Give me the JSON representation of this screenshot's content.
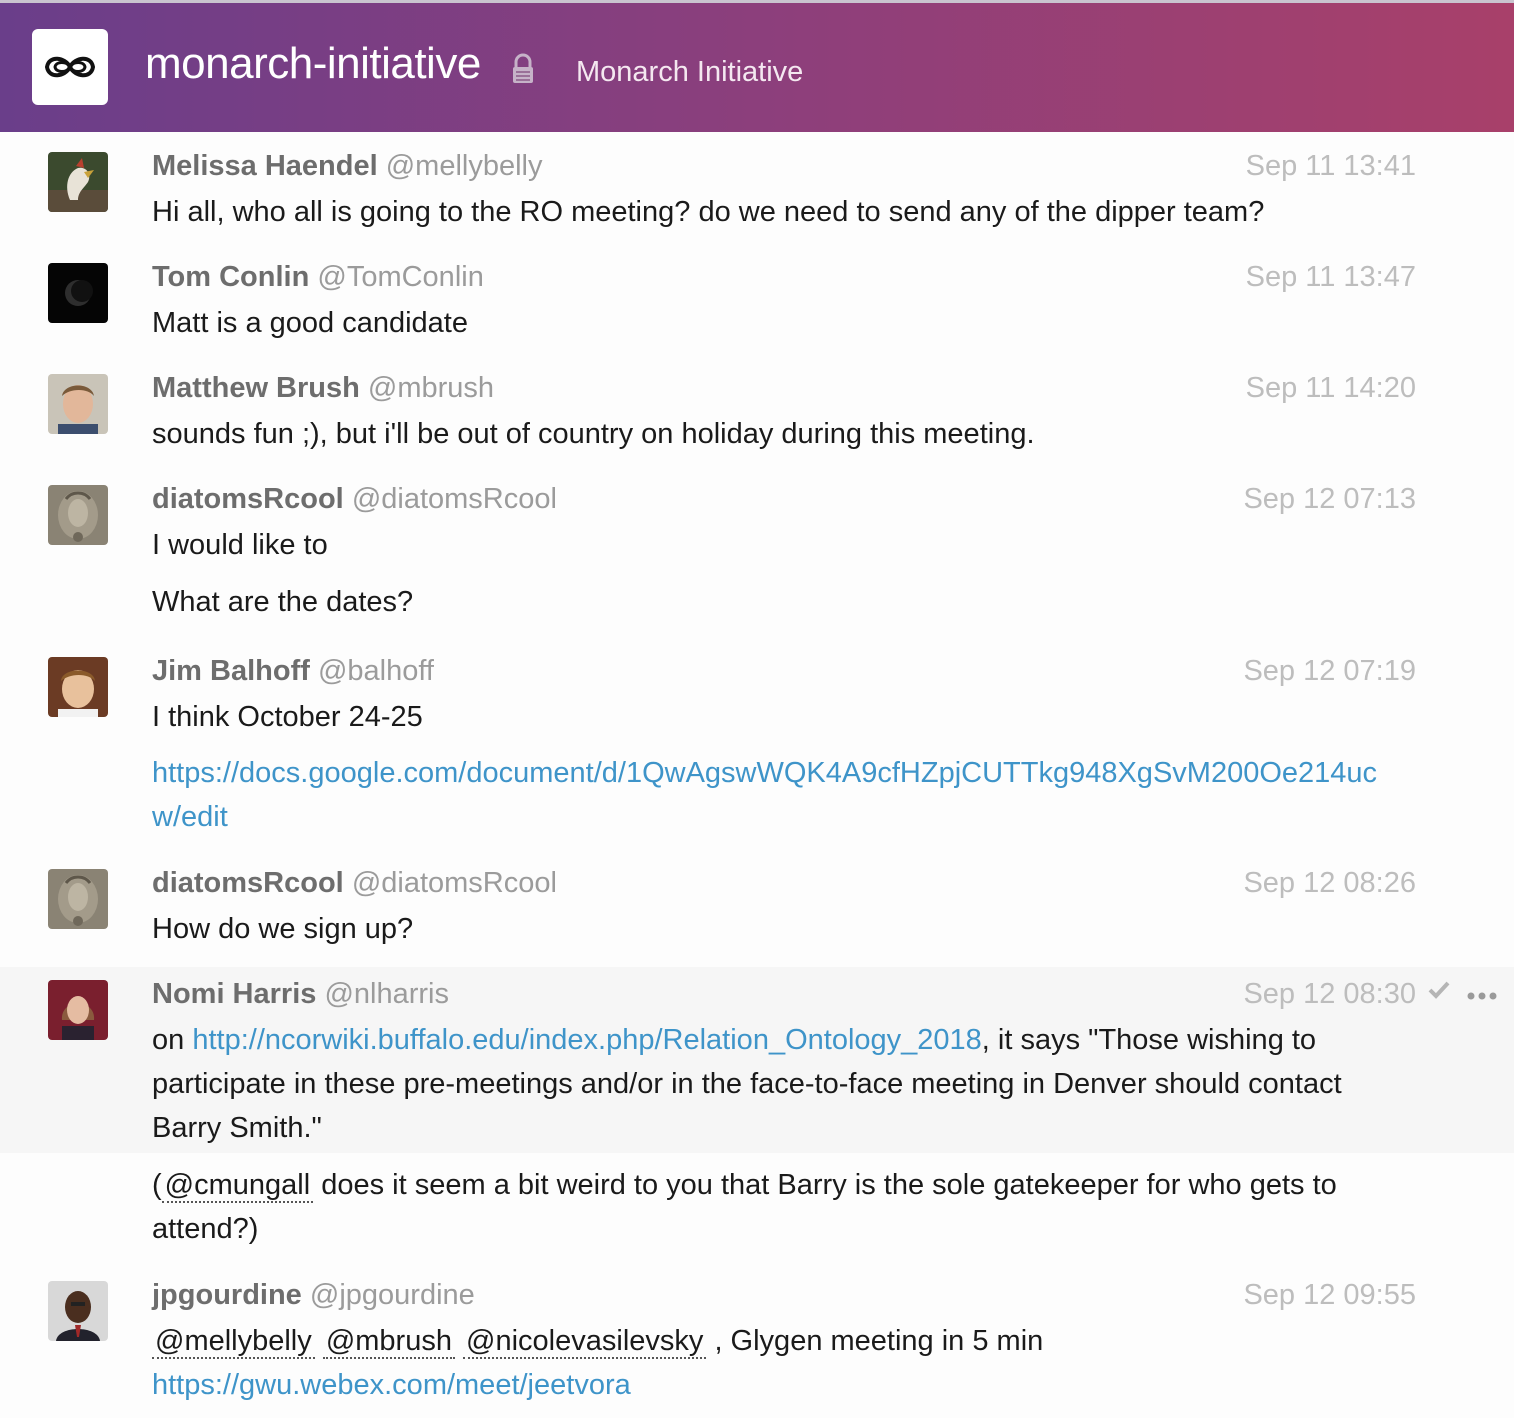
{
  "header": {
    "room_name": "monarch-initiative",
    "room_topic": "Monarch Initiative"
  },
  "messages": [
    {
      "display_name": "Melissa Haendel",
      "username": "@mellybelly",
      "timestamp": "Sep 11 13:41",
      "text": "Hi all, who all is going to the RO meeting? do we need to send any of the dipper team?"
    },
    {
      "display_name": "Tom Conlin",
      "username": "@TomConlin",
      "timestamp": "Sep 11 13:47",
      "text": "Matt is a good candidate"
    },
    {
      "display_name": "Matthew Brush",
      "username": "@mbrush",
      "timestamp": "Sep 11 14:20",
      "text": "sounds fun ;), but i'll be out of country on holiday during this meeting."
    },
    {
      "display_name": "diatomsRcool",
      "username": "@diatomsRcool",
      "timestamp": "Sep 12 07:13",
      "text": "I would like to",
      "followup": "What are the dates?"
    },
    {
      "display_name": "Jim Balhoff",
      "username": "@balhoff",
      "timestamp": "Sep 12 07:19",
      "text": "I think October 24-25",
      "followup_link": "https://docs.google.com/document/d/1QwAgswWQK4A9cfHZpjCUTTkg948XgSvM200Oe214ucw/edit"
    },
    {
      "display_name": "diatomsRcool",
      "username": "@diatomsRcool",
      "timestamp": "Sep 12 08:26",
      "text": "How do we sign up?"
    },
    {
      "display_name": "Nomi Harris",
      "username": "@nlharris",
      "timestamp": "Sep 12 08:30",
      "text_prefix": "on ",
      "link": "http://ncorwiki.buffalo.edu/index.php/Relation_Ontology_2018",
      "text_suffix": ", it says \"Those wishing to participate in these pre-meetings and/or in the face-to-face meeting in Denver should contact Barry Smith.\"",
      "followup_prefix": "(",
      "followup_mention": "@cmungall",
      "followup_suffix": " does it seem a bit weird to you that Barry is the sole gatekeeper for who gets to attend?)"
    },
    {
      "display_name": "jpgourdine",
      "username": "@jpgourdine",
      "timestamp": "Sep 12 09:55",
      "mentions": [
        "@mellybelly",
        "@mbrush",
        "@nicolevasilevsky"
      ],
      "text_suffix": " , Glygen meeting in 5 min",
      "link": "https://gwu.webex.com/meet/jeetvora"
    }
  ],
  "icons": {
    "logo": "infinity-logo-icon",
    "lock": "lock-icon",
    "read": "check-icon",
    "more": "more-icon"
  }
}
